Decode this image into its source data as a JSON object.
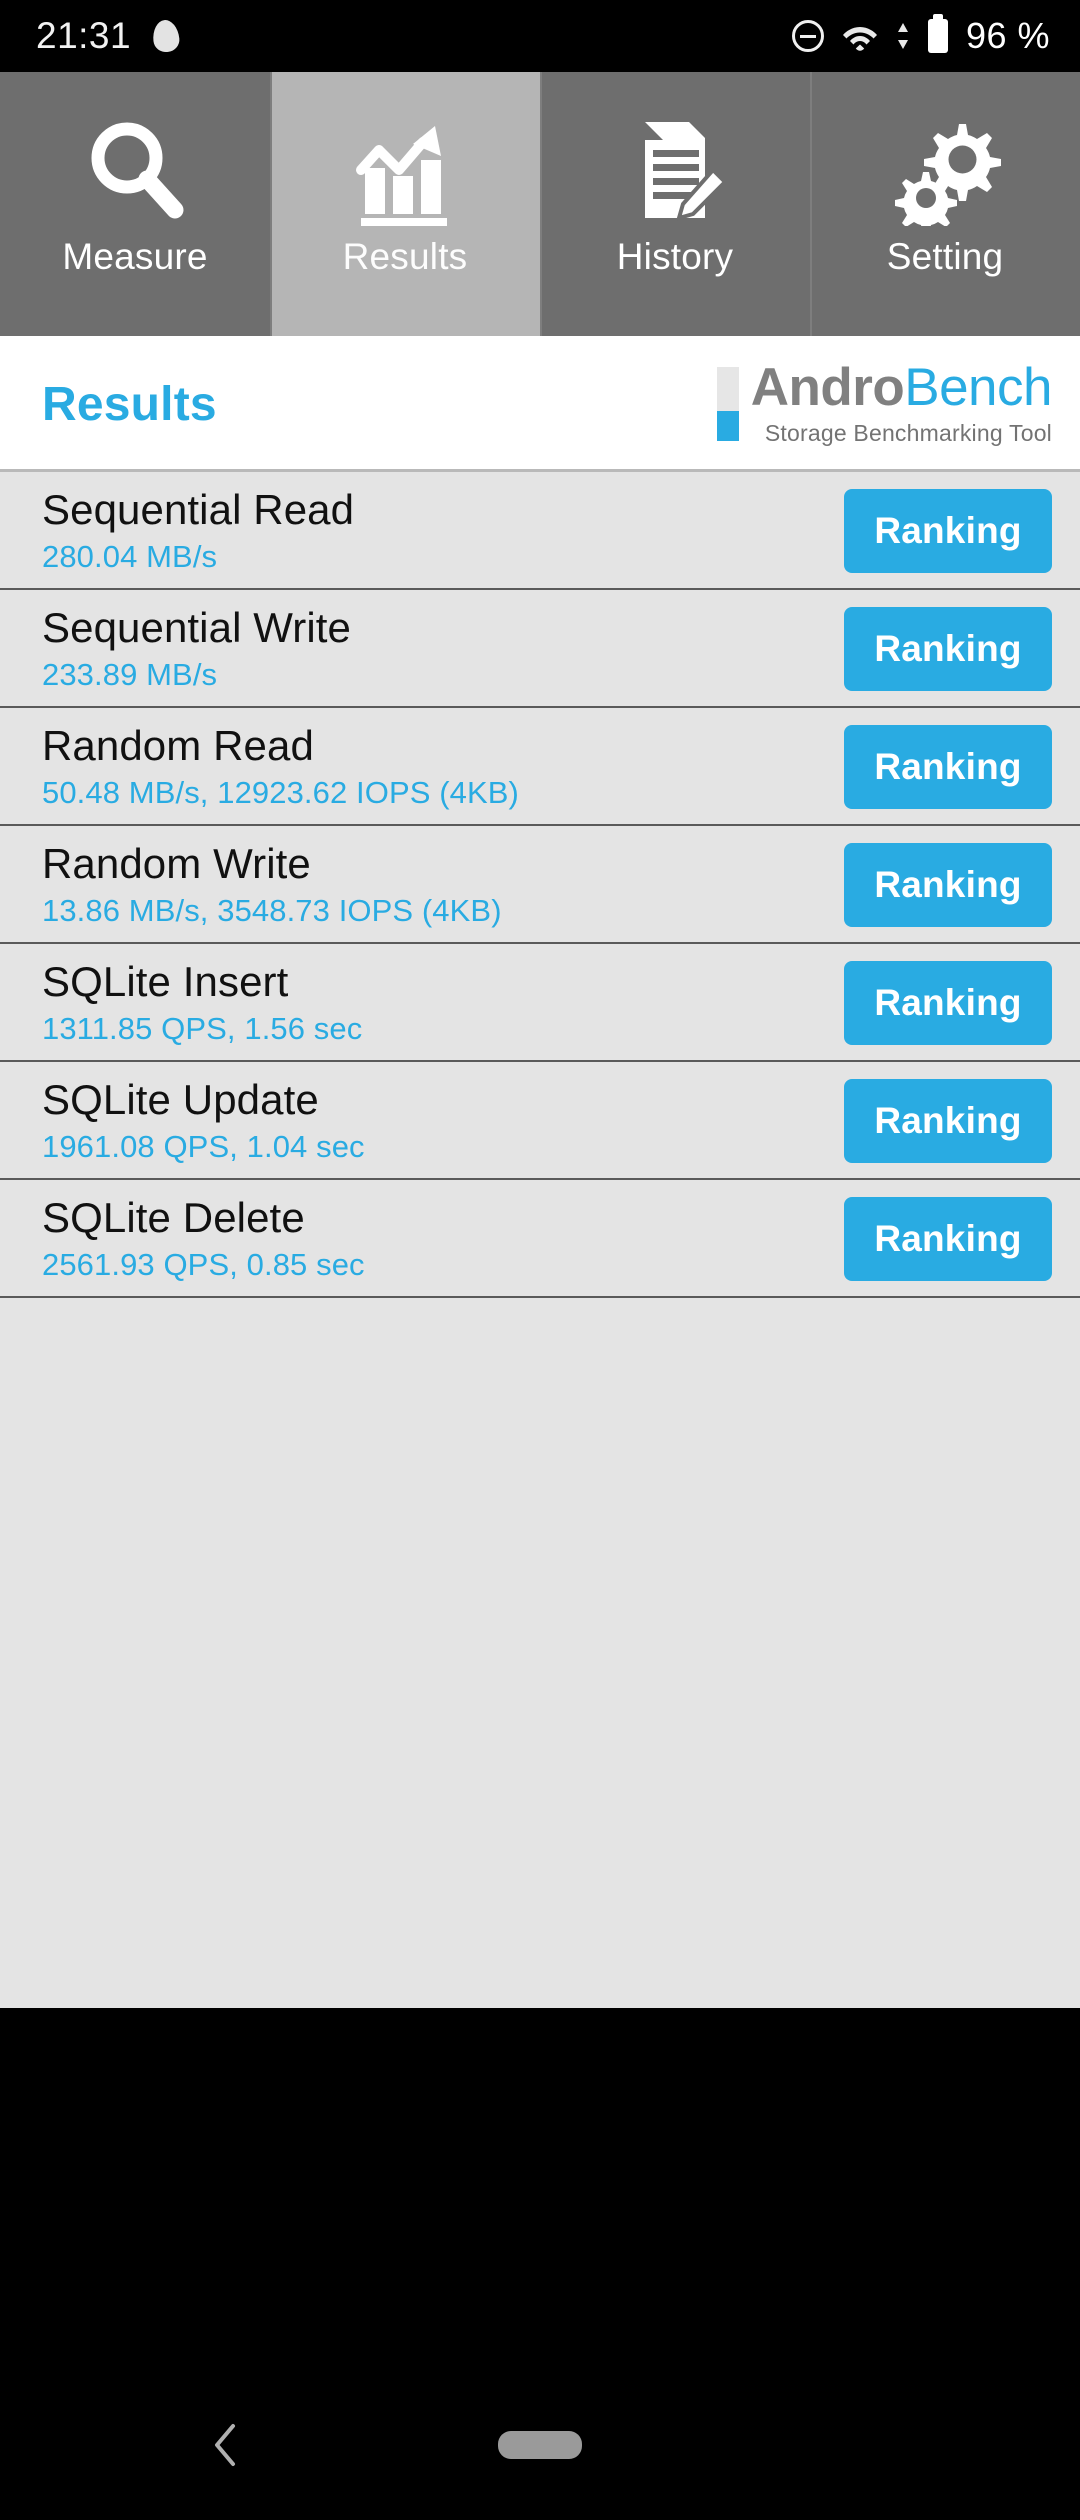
{
  "status_bar": {
    "time": "21:31",
    "battery_text": "96 %",
    "icons": [
      "flame-icon",
      "do-not-disturb-icon",
      "wifi-icon",
      "data-transfer-icon",
      "battery-icon"
    ]
  },
  "tabs": [
    {
      "label": "Measure",
      "icon": "magnifier-icon",
      "active": false
    },
    {
      "label": "Results",
      "icon": "bar-chart-arrow-icon",
      "active": true
    },
    {
      "label": "History",
      "icon": "document-pencil-icon",
      "active": false
    },
    {
      "label": "Setting",
      "icon": "gears-icon",
      "active": false
    }
  ],
  "header": {
    "page_title": "Results",
    "logo_part1": "Andro",
    "logo_part2": "Bench",
    "logo_subtitle": "Storage Benchmarking Tool"
  },
  "results": [
    {
      "title": "Sequential Read",
      "value": "280.04 MB/s",
      "button": "Ranking"
    },
    {
      "title": "Sequential Write",
      "value": "233.89 MB/s",
      "button": "Ranking"
    },
    {
      "title": "Random Read",
      "value": "50.48 MB/s, 12923.62 IOPS (4KB)",
      "button": "Ranking"
    },
    {
      "title": "Random Write",
      "value": "13.86 MB/s, 3548.73 IOPS (4KB)",
      "button": "Ranking"
    },
    {
      "title": "SQLite Insert",
      "value": "1311.85 QPS, 1.56 sec",
      "button": "Ranking"
    },
    {
      "title": "SQLite Update",
      "value": "1961.08 QPS, 1.04 sec",
      "button": "Ranking"
    },
    {
      "title": "SQLite Delete",
      "value": "2561.93 QPS, 0.85 sec",
      "button": "Ranking"
    }
  ],
  "nav_bar": {
    "back_icon": "chevron-left-icon",
    "home_icon": "home-pill-icon"
  },
  "colors": {
    "accent_blue": "#29ABE2",
    "tab_inactive": "#6e6e6e",
    "tab_active": "#b5b5b5",
    "list_bg": "#e4e4e4",
    "header_bg": "#ffffff",
    "status_bg": "#000000"
  }
}
